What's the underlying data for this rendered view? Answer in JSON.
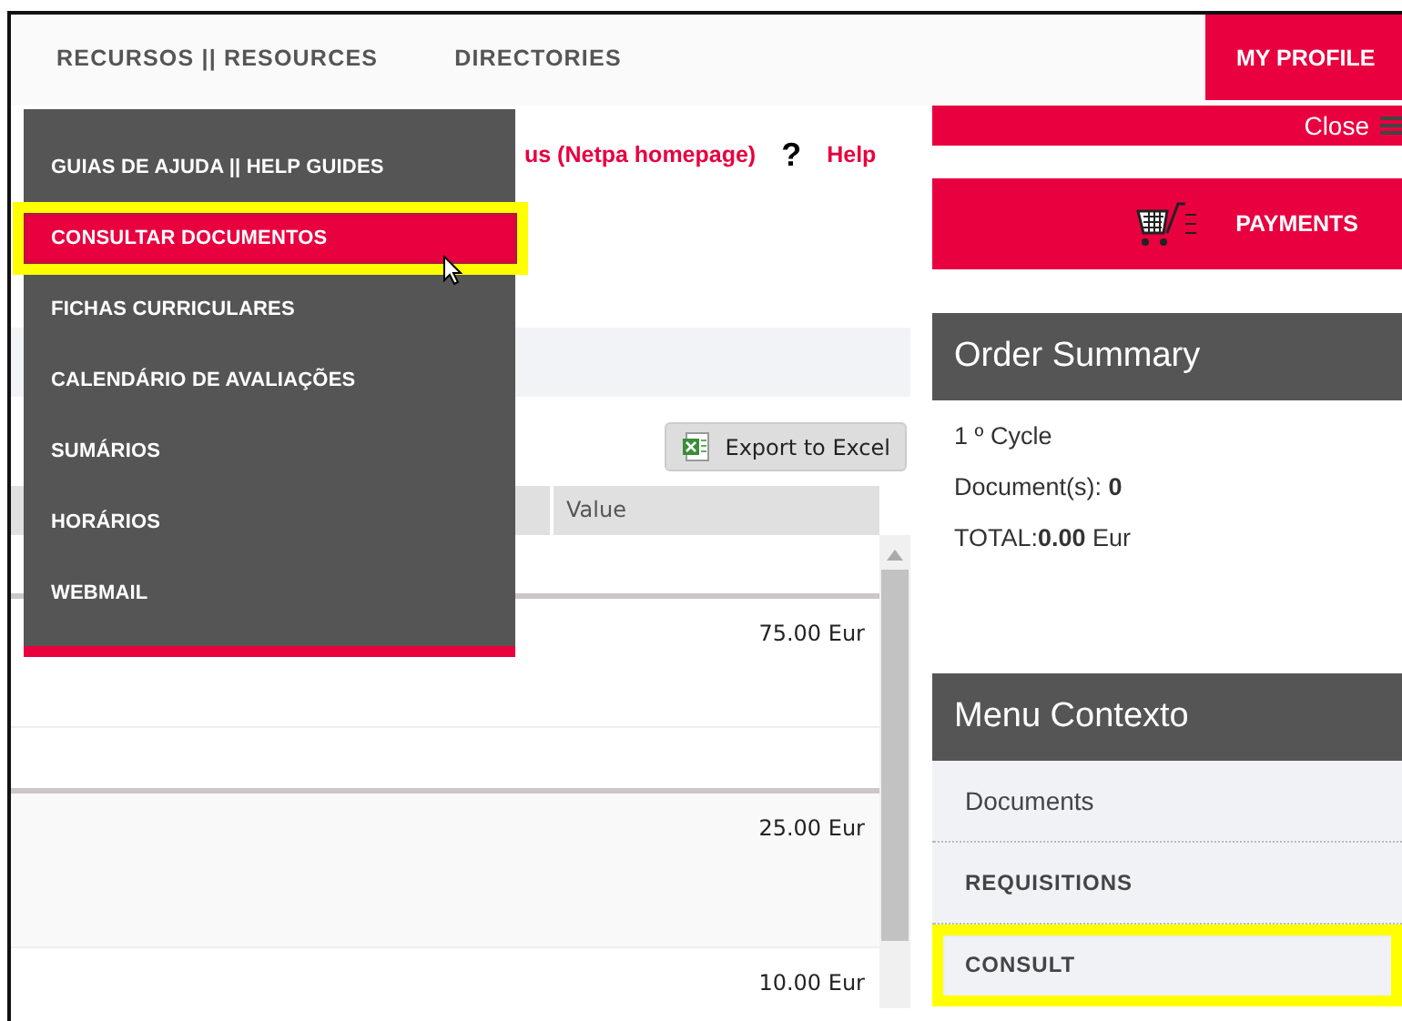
{
  "nav": {
    "items": [
      {
        "label": "RECURSOS || RESOURCES"
      },
      {
        "label": "DIRECTORIES"
      }
    ],
    "profile": "MY PROFILE"
  },
  "dropdown": {
    "items": [
      {
        "label": "GUIAS DE AJUDA || HELP GUIDES",
        "selected": false,
        "highlighted": false
      },
      {
        "label": "CONSULTAR DOCUMENTOS",
        "selected": true,
        "highlighted": true
      },
      {
        "label": "FICHAS CURRICULARES",
        "selected": false,
        "highlighted": false
      },
      {
        "label": "CALENDÁRIO DE AVALIAÇÕES",
        "selected": false,
        "highlighted": false
      },
      {
        "label": "SUMÁRIOS",
        "selected": false,
        "highlighted": false
      },
      {
        "label": "HORÁRIOS",
        "selected": false,
        "highlighted": false
      },
      {
        "label": "WEBMAIL",
        "selected": false,
        "highlighted": false
      }
    ]
  },
  "links": {
    "homepage": "us (Netpa homepage)",
    "help_mark": "?",
    "help": "Help"
  },
  "export_button": "Export to Excel",
  "table": {
    "columns": [
      "Value"
    ],
    "rows": [
      {
        "value": "75.00 Eur"
      },
      {
        "value": "25.00 Eur"
      },
      {
        "value": "10.00 Eur"
      }
    ]
  },
  "sidebar": {
    "close": "Close",
    "payments": "PAYMENTS",
    "order_summary": {
      "title": "Order Summary",
      "cycle": "1 º Cycle",
      "documents_label": "Document(s):",
      "documents_value": "0",
      "total_label": "TOTAL:",
      "total_value": "0.00",
      "total_unit": "Eur"
    },
    "context_menu": {
      "title": "Menu Contexto",
      "items": [
        {
          "label": "Documents",
          "kind": "link",
          "highlighted": false
        },
        {
          "label": "REQUISITIONS",
          "kind": "section",
          "highlighted": false
        },
        {
          "label": "CONSULT",
          "kind": "section",
          "highlighted": true
        }
      ]
    }
  }
}
